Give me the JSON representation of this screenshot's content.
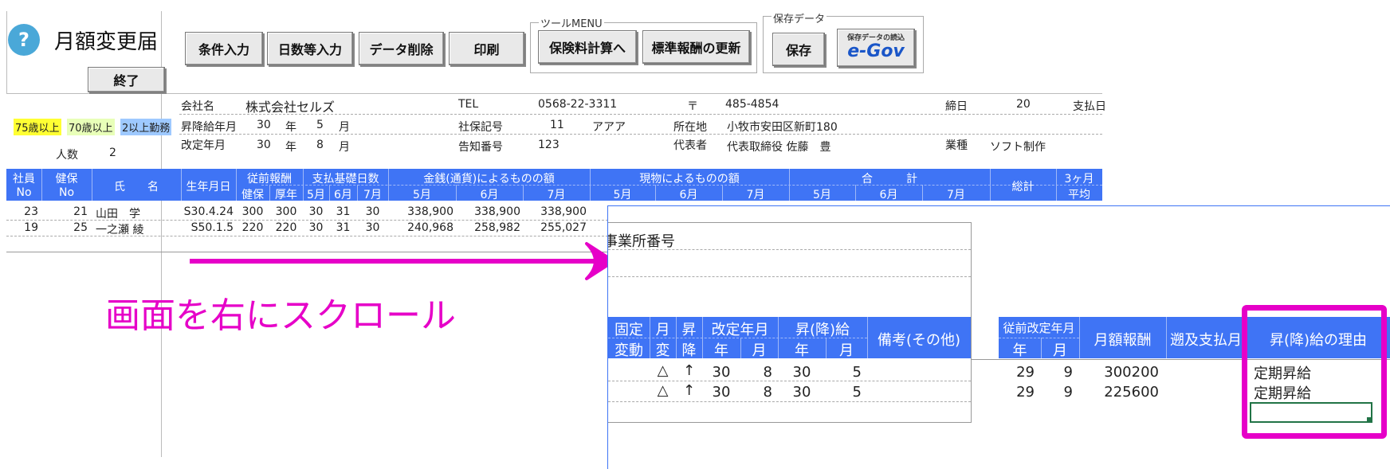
{
  "app": {
    "title": "月額変更届",
    "help_glyph": "?",
    "exit_label": "終了"
  },
  "toolbar": {
    "buttons": [
      "条件入力",
      "日数等入力",
      "データ削除",
      "印刷"
    ]
  },
  "tool_menu": {
    "label": "ツールMENU",
    "buttons": [
      "保険料計算へ",
      "標準報酬の更新"
    ]
  },
  "save_group": {
    "label": "保存データ",
    "save_label": "保存",
    "egov_caption": "保存データの読込",
    "egov_logo": "e-Gov"
  },
  "info": {
    "company_label": "会社名",
    "company": "株式会社セルズ",
    "tel_label": "TEL",
    "tel": "0568-22-3311",
    "postal_label": "〒",
    "postal": "485-4854",
    "close_label": "締日",
    "close_day": "20",
    "pay_label": "支払日",
    "raise_label": "昇降給年月",
    "raise_year": "30",
    "raise_month": "5",
    "year_unit": "年",
    "month_unit": "月",
    "insurance_label": "社保記号",
    "insurance_no": "11",
    "insurance_kana": "アアア",
    "address_label": "所在地",
    "address": "小牧市安田区新町180",
    "revise_label": "改定年月",
    "revise_year": "30",
    "revise_month": "8",
    "notice_label": "告知番号",
    "notice_no": "123",
    "rep_label": "代表者",
    "rep": "代表取締役 佐藤　豊",
    "industry_label": "業種",
    "industry": "ソフト制作"
  },
  "legend": {
    "age75": "75歳以上",
    "age70": "70歳以上",
    "multi": "2以上勤務",
    "age75_color": "#ffff33",
    "age70_color": "#e8ffb8",
    "multi_color": "#9ec9ff"
  },
  "headcount": {
    "label": "人数",
    "value": "2"
  },
  "table": {
    "h_emp": [
      "社員",
      "No"
    ],
    "h_ins": [
      "健保",
      "No"
    ],
    "h_name": "氏　　名",
    "h_birth": "生年月日",
    "h_prev": "従前報酬",
    "h_prev_sub": [
      "健保",
      "厚年"
    ],
    "h_days": "支払基礎日数",
    "h_months": [
      "5月",
      "6月",
      "7月"
    ],
    "h_cash": "金銭(通貨)によるものの額",
    "h_kind": "現物によるものの額",
    "h_sum": "合　　　計",
    "h_total": "総計",
    "h_avg": "3ヶ月",
    "h_avg2": "平均",
    "rows": [
      {
        "emp": "23",
        "ins": "21",
        "name": "山田　学",
        "birth": "S30.4.24",
        "kenpo": "300",
        "kounen": "300",
        "d5": "30",
        "d6": "31",
        "d7": "30",
        "c5": "338,900",
        "c6": "338,900",
        "c7": "338,900"
      },
      {
        "emp": "19",
        "ins": "25",
        "name": "一之瀬 綾",
        "birth": "S50.1.5",
        "kenpo": "220",
        "kounen": "220",
        "d5": "30",
        "d6": "31",
        "d7": "30",
        "c5": "240,968",
        "c6": "258,982",
        "c7": "255,027"
      }
    ]
  },
  "annotation": {
    "text": "画面を右にスクロール",
    "color": "#e600c8"
  },
  "zoom": {
    "office_label": "事業所番号",
    "h_fixed": [
      "固定",
      "変動"
    ],
    "h_mon": [
      "月",
      "変"
    ],
    "h_up": [
      "昇",
      "降"
    ],
    "h_revise": "改定年月",
    "h_raise": "昇(降)給",
    "h_ym": [
      "年",
      "月"
    ],
    "h_note": "備考(その他)",
    "h_prevrev": "従前改定年月",
    "h_monthly": "月額報酬",
    "h_retro": "遡及支払月",
    "h_reason": "昇(降)給の理由",
    "rows": [
      {
        "fixed": "△",
        "arrow": "↑",
        "ry": "30",
        "rm": "8",
        "ay": "30",
        "am": "5",
        "py": "29",
        "pm": "9",
        "monthly": "300200",
        "reason": "定期昇給"
      },
      {
        "fixed": "△",
        "arrow": "↑",
        "ry": "30",
        "rm": "8",
        "ay": "30",
        "am": "5",
        "py": "29",
        "pm": "9",
        "monthly": "225600",
        "reason": "定期昇給"
      }
    ]
  }
}
